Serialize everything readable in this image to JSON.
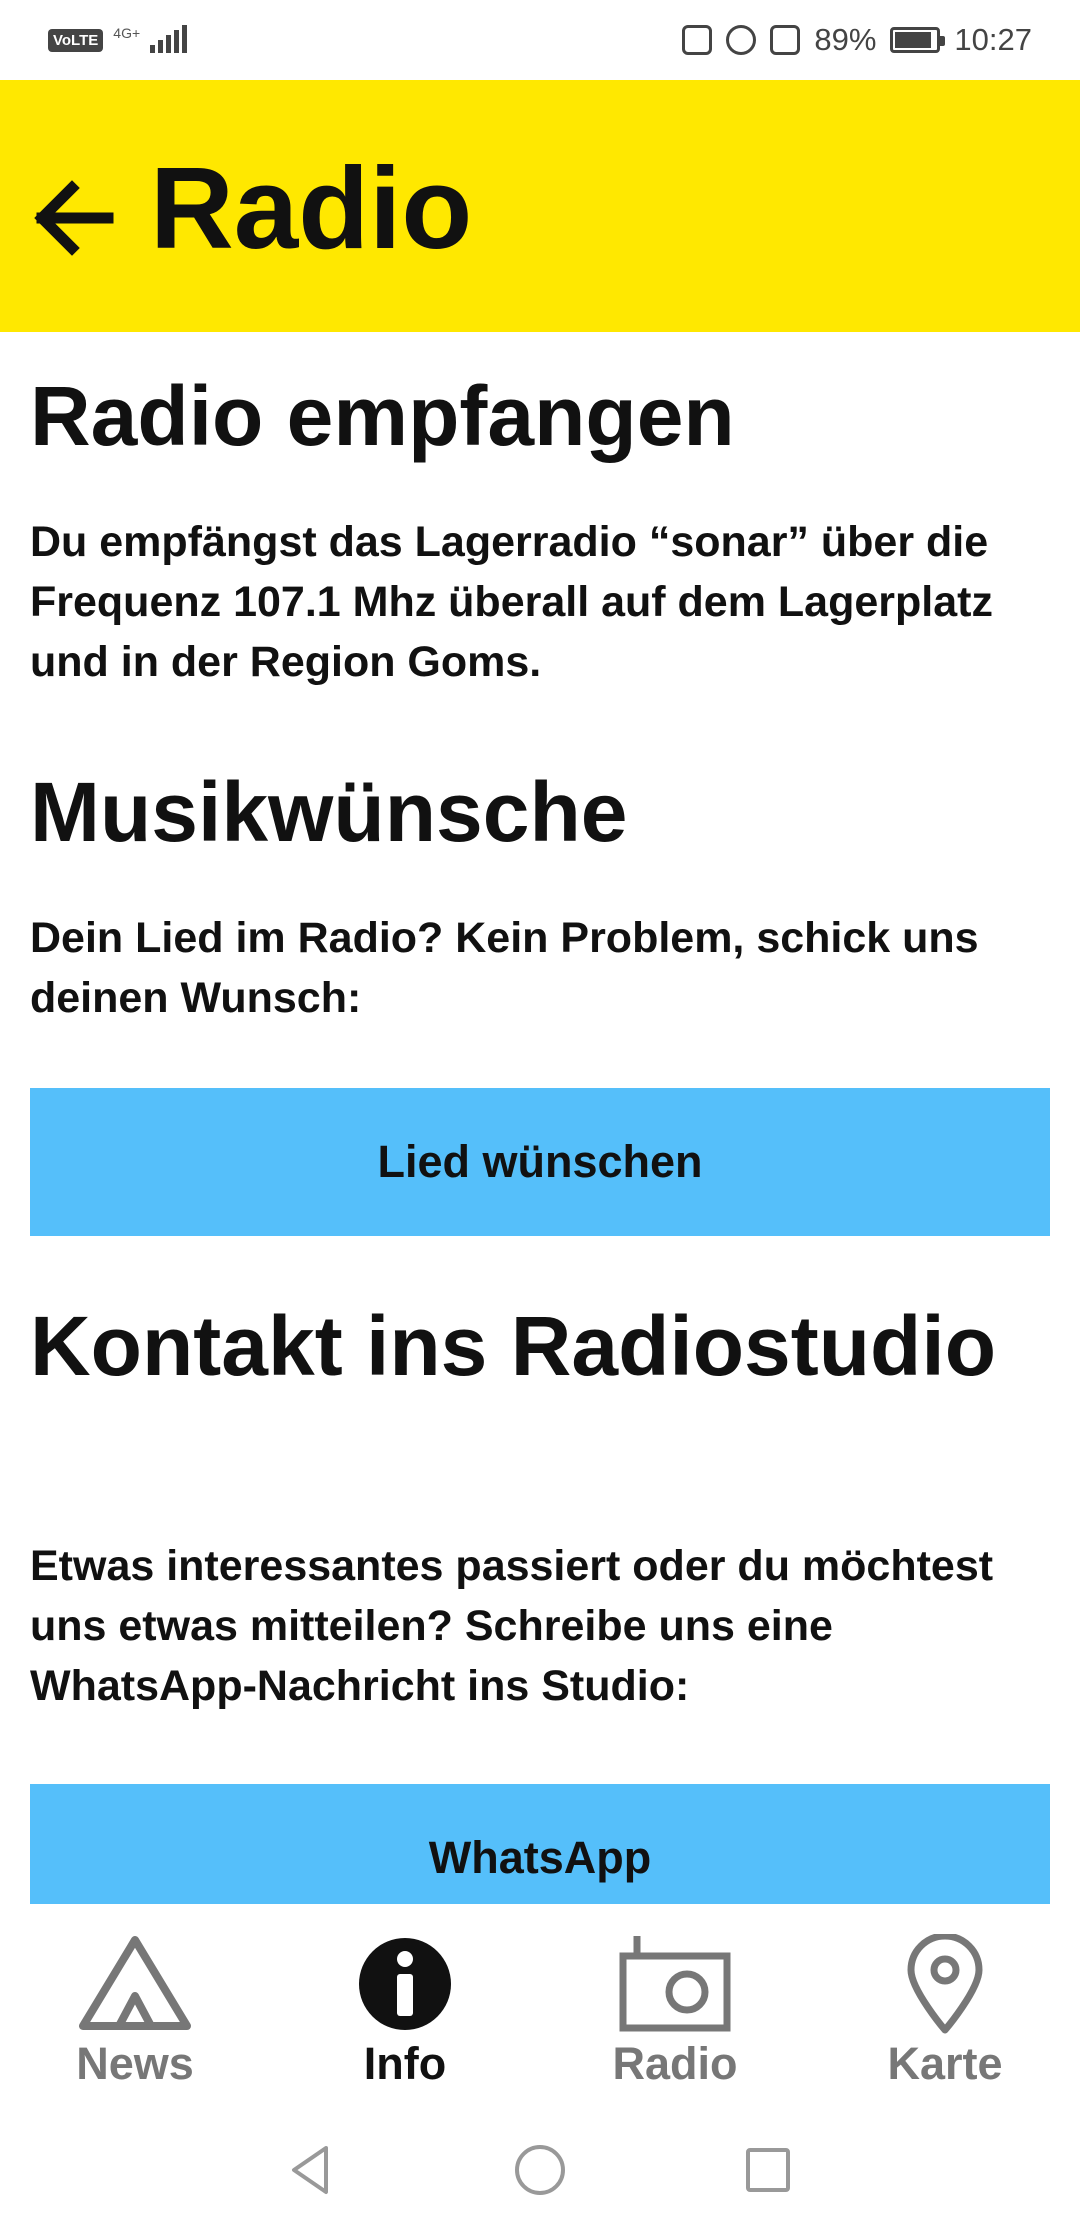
{
  "status_bar": {
    "volte": "VoLTE",
    "network": "4G+",
    "battery_percent": "89%",
    "battery_level": 0.89,
    "time": "10:27",
    "icons": [
      "nfc-icon",
      "alarm-icon",
      "vibrate-icon",
      "battery-icon"
    ]
  },
  "app_bar": {
    "title": "Radio",
    "background": "#ffe800",
    "back_icon": "arrow-left-icon"
  },
  "sections": [
    {
      "heading": "Radio empfangen",
      "text": "Du empfängst das Lagerradio “sonar” über die Frequenz 107.1 Mhz überall auf dem Lagerplatz und in der Region Goms."
    },
    {
      "heading": "Musikwünsche",
      "text": "Dein Lied im Radio? Kein Problem, schick uns deinen Wunsch:",
      "button": "Lied wünschen"
    },
    {
      "heading": "Kontakt ins Radiostudio",
      "text": "Etwas interessantes passiert oder du möchtest uns etwas mitteilen? Schreibe uns eine WhatsApp-Nachricht ins Studio:",
      "button": "WhatsApp"
    }
  ],
  "button_color": "#55bffa",
  "bottom_nav": [
    {
      "label": "News",
      "icon": "tent-icon",
      "active": false
    },
    {
      "label": "Info",
      "icon": "info-icon",
      "active": true
    },
    {
      "label": "Radio",
      "icon": "radio-icon",
      "active": false
    },
    {
      "label": "Karte",
      "icon": "map-pin-icon",
      "active": false
    }
  ],
  "system_nav": [
    "back-triangle-icon",
    "home-circle-icon",
    "recents-square-icon"
  ]
}
